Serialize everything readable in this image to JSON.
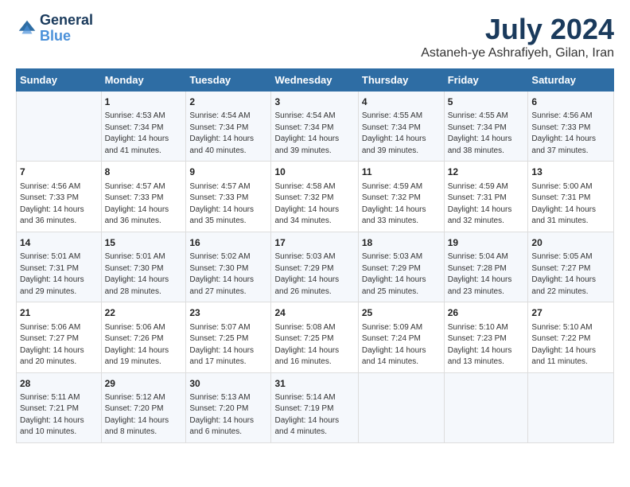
{
  "logo": {
    "line1": "General",
    "line2": "Blue"
  },
  "title": "July 2024",
  "subtitle": "Astaneh-ye Ashrafiyeh, Gilan, Iran",
  "days_of_week": [
    "Sunday",
    "Monday",
    "Tuesday",
    "Wednesday",
    "Thursday",
    "Friday",
    "Saturday"
  ],
  "weeks": [
    [
      {
        "day": "",
        "info": ""
      },
      {
        "day": "1",
        "info": "Sunrise: 4:53 AM\nSunset: 7:34 PM\nDaylight: 14 hours\nand 41 minutes."
      },
      {
        "day": "2",
        "info": "Sunrise: 4:54 AM\nSunset: 7:34 PM\nDaylight: 14 hours\nand 40 minutes."
      },
      {
        "day": "3",
        "info": "Sunrise: 4:54 AM\nSunset: 7:34 PM\nDaylight: 14 hours\nand 39 minutes."
      },
      {
        "day": "4",
        "info": "Sunrise: 4:55 AM\nSunset: 7:34 PM\nDaylight: 14 hours\nand 39 minutes."
      },
      {
        "day": "5",
        "info": "Sunrise: 4:55 AM\nSunset: 7:34 PM\nDaylight: 14 hours\nand 38 minutes."
      },
      {
        "day": "6",
        "info": "Sunrise: 4:56 AM\nSunset: 7:33 PM\nDaylight: 14 hours\nand 37 minutes."
      }
    ],
    [
      {
        "day": "7",
        "info": "Sunrise: 4:56 AM\nSunset: 7:33 PM\nDaylight: 14 hours\nand 36 minutes."
      },
      {
        "day": "8",
        "info": "Sunrise: 4:57 AM\nSunset: 7:33 PM\nDaylight: 14 hours\nand 36 minutes."
      },
      {
        "day": "9",
        "info": "Sunrise: 4:57 AM\nSunset: 7:33 PM\nDaylight: 14 hours\nand 35 minutes."
      },
      {
        "day": "10",
        "info": "Sunrise: 4:58 AM\nSunset: 7:32 PM\nDaylight: 14 hours\nand 34 minutes."
      },
      {
        "day": "11",
        "info": "Sunrise: 4:59 AM\nSunset: 7:32 PM\nDaylight: 14 hours\nand 33 minutes."
      },
      {
        "day": "12",
        "info": "Sunrise: 4:59 AM\nSunset: 7:31 PM\nDaylight: 14 hours\nand 32 minutes."
      },
      {
        "day": "13",
        "info": "Sunrise: 5:00 AM\nSunset: 7:31 PM\nDaylight: 14 hours\nand 31 minutes."
      }
    ],
    [
      {
        "day": "14",
        "info": "Sunrise: 5:01 AM\nSunset: 7:31 PM\nDaylight: 14 hours\nand 29 minutes."
      },
      {
        "day": "15",
        "info": "Sunrise: 5:01 AM\nSunset: 7:30 PM\nDaylight: 14 hours\nand 28 minutes."
      },
      {
        "day": "16",
        "info": "Sunrise: 5:02 AM\nSunset: 7:30 PM\nDaylight: 14 hours\nand 27 minutes."
      },
      {
        "day": "17",
        "info": "Sunrise: 5:03 AM\nSunset: 7:29 PM\nDaylight: 14 hours\nand 26 minutes."
      },
      {
        "day": "18",
        "info": "Sunrise: 5:03 AM\nSunset: 7:29 PM\nDaylight: 14 hours\nand 25 minutes."
      },
      {
        "day": "19",
        "info": "Sunrise: 5:04 AM\nSunset: 7:28 PM\nDaylight: 14 hours\nand 23 minutes."
      },
      {
        "day": "20",
        "info": "Sunrise: 5:05 AM\nSunset: 7:27 PM\nDaylight: 14 hours\nand 22 minutes."
      }
    ],
    [
      {
        "day": "21",
        "info": "Sunrise: 5:06 AM\nSunset: 7:27 PM\nDaylight: 14 hours\nand 20 minutes."
      },
      {
        "day": "22",
        "info": "Sunrise: 5:06 AM\nSunset: 7:26 PM\nDaylight: 14 hours\nand 19 minutes."
      },
      {
        "day": "23",
        "info": "Sunrise: 5:07 AM\nSunset: 7:25 PM\nDaylight: 14 hours\nand 17 minutes."
      },
      {
        "day": "24",
        "info": "Sunrise: 5:08 AM\nSunset: 7:25 PM\nDaylight: 14 hours\nand 16 minutes."
      },
      {
        "day": "25",
        "info": "Sunrise: 5:09 AM\nSunset: 7:24 PM\nDaylight: 14 hours\nand 14 minutes."
      },
      {
        "day": "26",
        "info": "Sunrise: 5:10 AM\nSunset: 7:23 PM\nDaylight: 14 hours\nand 13 minutes."
      },
      {
        "day": "27",
        "info": "Sunrise: 5:10 AM\nSunset: 7:22 PM\nDaylight: 14 hours\nand 11 minutes."
      }
    ],
    [
      {
        "day": "28",
        "info": "Sunrise: 5:11 AM\nSunset: 7:21 PM\nDaylight: 14 hours\nand 10 minutes."
      },
      {
        "day": "29",
        "info": "Sunrise: 5:12 AM\nSunset: 7:20 PM\nDaylight: 14 hours\nand 8 minutes."
      },
      {
        "day": "30",
        "info": "Sunrise: 5:13 AM\nSunset: 7:20 PM\nDaylight: 14 hours\nand 6 minutes."
      },
      {
        "day": "31",
        "info": "Sunrise: 5:14 AM\nSunset: 7:19 PM\nDaylight: 14 hours\nand 4 minutes."
      },
      {
        "day": "",
        "info": ""
      },
      {
        "day": "",
        "info": ""
      },
      {
        "day": "",
        "info": ""
      }
    ]
  ]
}
